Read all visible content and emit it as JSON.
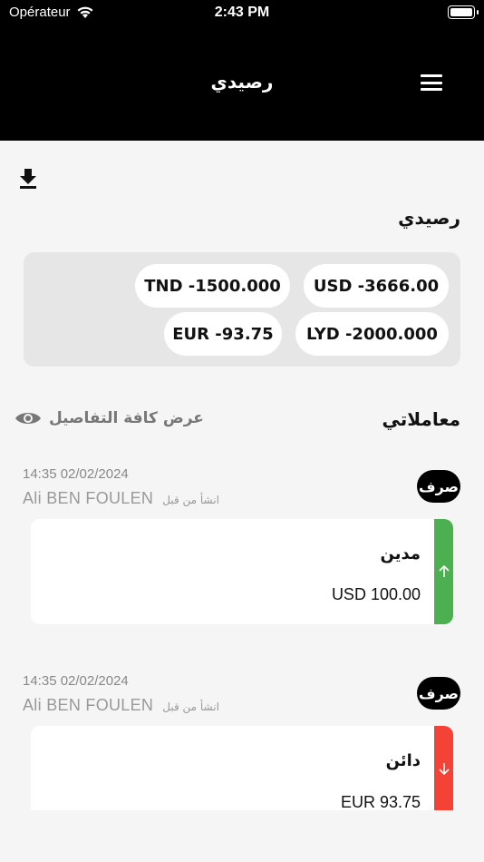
{
  "status_bar": {
    "carrier": "Opérateur",
    "time": "2:43 PM"
  },
  "header": {
    "title": "رصيدي"
  },
  "balance": {
    "title": "رصيدي",
    "chips": [
      {
        "text": "USD -3666.00"
      },
      {
        "text": "TND -1500.000"
      },
      {
        "text": "LYD -2000.000"
      },
      {
        "text": "EUR -93.75"
      }
    ]
  },
  "transactions": {
    "title": "معاملاتي",
    "details_label": "عرض كافة التفاصيل",
    "items": [
      {
        "datetime": "14:35 02/02/2024",
        "created_by_label": "انشأ من قبل",
        "user": "Ali BEN FOULEN",
        "type": "صرف",
        "label": "مدين",
        "amount": "USD 100.00",
        "direction": "up",
        "color": "#4caf50"
      },
      {
        "datetime": "14:35 02/02/2024",
        "created_by_label": "انشأ من قبل",
        "user": "Ali BEN FOULEN",
        "type": "صرف",
        "label": "دائن",
        "amount": "EUR 93.75",
        "direction": "down",
        "color": "#f44336"
      }
    ]
  },
  "icons": {
    "menu": "hamburger-icon",
    "download": "download-icon",
    "details": "eye-icon",
    "wifi": "wifi-icon",
    "battery": "battery-icon"
  }
}
